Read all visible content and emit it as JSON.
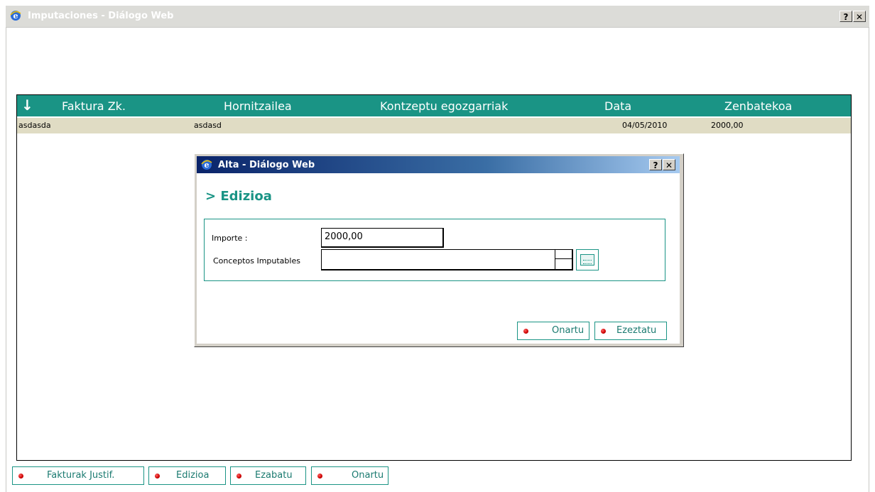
{
  "outer_window": {
    "title": "Imputaciones - Diálogo Web",
    "help_btn": "?",
    "close_btn": "✕"
  },
  "table": {
    "sort_icon": "↓",
    "columns": [
      "Faktura Zk.",
      "Hornitzailea",
      "Kontzeptu egozgarriak",
      "Data",
      "Zenbatekoa"
    ],
    "rows": [
      [
        "asdasda",
        "asdasd",
        "",
        "04/05/2010",
        "2000,00"
      ]
    ]
  },
  "dialog": {
    "title": "Alta - Diálogo Web",
    "help_btn": "?",
    "close_btn": "✕",
    "heading": "> Edizioa",
    "importe_label": "Importe  :",
    "importe_value": "2000,00",
    "conceptos_label": "Conceptos Imputables",
    "conceptos_value": "",
    "onartu_label": "Onartu",
    "ezeztatu_label": "Ezeztatu"
  },
  "bottom_buttons": {
    "fakturak": "Fakturak Justif.",
    "edizioa": "Edizioa",
    "ezabatu": "Ezabatu",
    "onartu": "Onartu"
  },
  "colors": {
    "accent": "#1a9485",
    "row_bg": "#e0dcc4",
    "dialog_title_start": "#0a246a"
  },
  "icons": {
    "app": "ie-icon",
    "keyboard": "keyboard-icon",
    "bullet": "red-bullet-icon"
  }
}
